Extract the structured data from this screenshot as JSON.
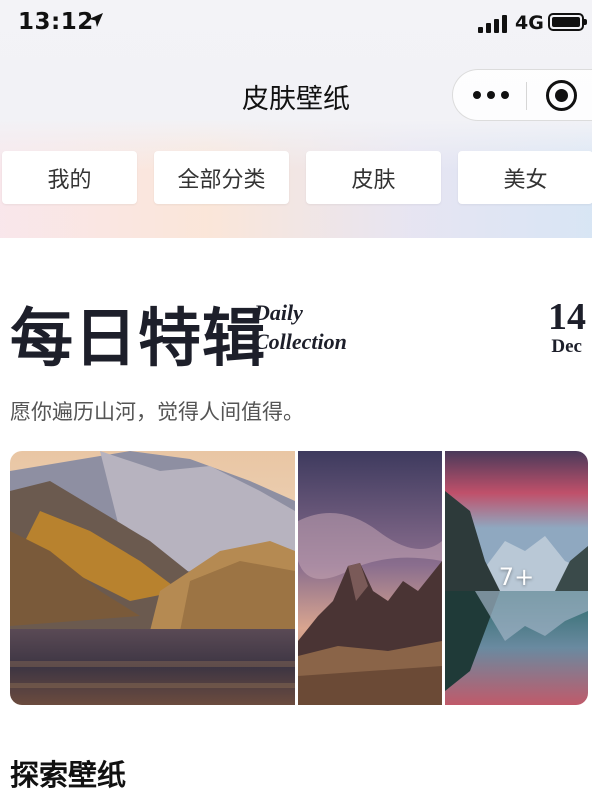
{
  "status_bar": {
    "time": "13:12",
    "network": "4G"
  },
  "nav": {
    "title": "皮肤壁纸"
  },
  "tabs": [
    {
      "label": "我的"
    },
    {
      "label": "全部分类"
    },
    {
      "label": "皮肤"
    },
    {
      "label": "美女"
    }
  ],
  "daily": {
    "title_cn": "每日特辑",
    "title_en_line1": "Daily",
    "title_en_line2": "Collection",
    "day": "14",
    "month": "Dec",
    "quote": "愿你遍历山河，觉得人间值得。",
    "more_count": "7+"
  },
  "explore": {
    "title": "探索壁纸"
  },
  "icons": [
    "location-arrow-icon",
    "signal-bars-icon",
    "battery-icon",
    "more-dots-icon",
    "close-target-icon"
  ]
}
